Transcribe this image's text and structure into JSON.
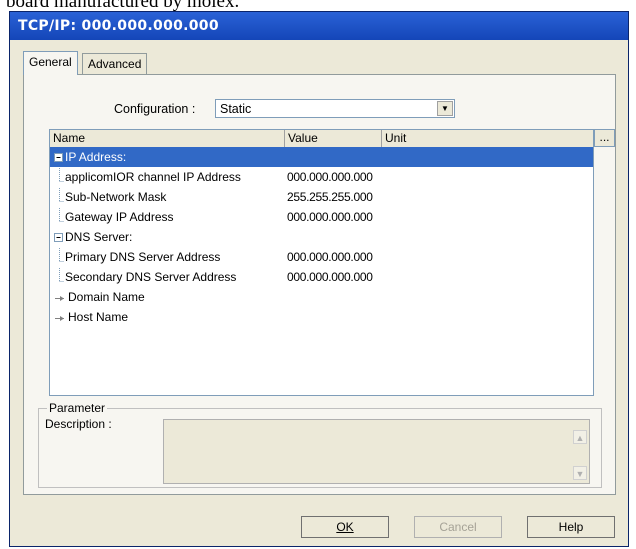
{
  "caption_fragment": "board manufactured by molex.",
  "window": {
    "title": "TCP/IP: 000.000.000.000"
  },
  "tabs": [
    {
      "label": "General",
      "active": true
    },
    {
      "label": "Advanced",
      "active": false
    }
  ],
  "configuration": {
    "label": "Configuration :",
    "value": "Static"
  },
  "list": {
    "columns": [
      "Name",
      "Value",
      "Unit"
    ],
    "more_button": "...",
    "rows": [
      {
        "name": "IP Address:",
        "value": "",
        "unit": "",
        "kind": "group"
      },
      {
        "name": "applicomIOR channel IP Address",
        "value": "000.000.000.000",
        "unit": "",
        "kind": "leaf"
      },
      {
        "name": "Sub-Network Mask",
        "value": "255.255.255.000",
        "unit": "",
        "kind": "leaf"
      },
      {
        "name": "Gateway IP Address",
        "value": "000.000.000.000",
        "unit": "",
        "kind": "leaf"
      },
      {
        "name": "DNS Server:",
        "value": "",
        "unit": "",
        "kind": "group"
      },
      {
        "name": "Primary DNS Server Address",
        "value": "000.000.000.000",
        "unit": "",
        "kind": "leaf"
      },
      {
        "name": "Secondary DNS Server Address",
        "value": "000.000.000.000",
        "unit": "",
        "kind": "leaf"
      },
      {
        "name": "Domain Name",
        "value": "",
        "unit": "",
        "kind": "arrow"
      },
      {
        "name": "Host Name",
        "value": "",
        "unit": "",
        "kind": "arrow"
      }
    ]
  },
  "parameter": {
    "title": "Parameter",
    "description_label": "Description :",
    "description_value": ""
  },
  "buttons": {
    "ok": "OK",
    "cancel": "Cancel",
    "help": "Help"
  },
  "colors": {
    "selection": "#3169c6",
    "titlebar": "#1446b8",
    "dialog": "#ece9d8"
  }
}
